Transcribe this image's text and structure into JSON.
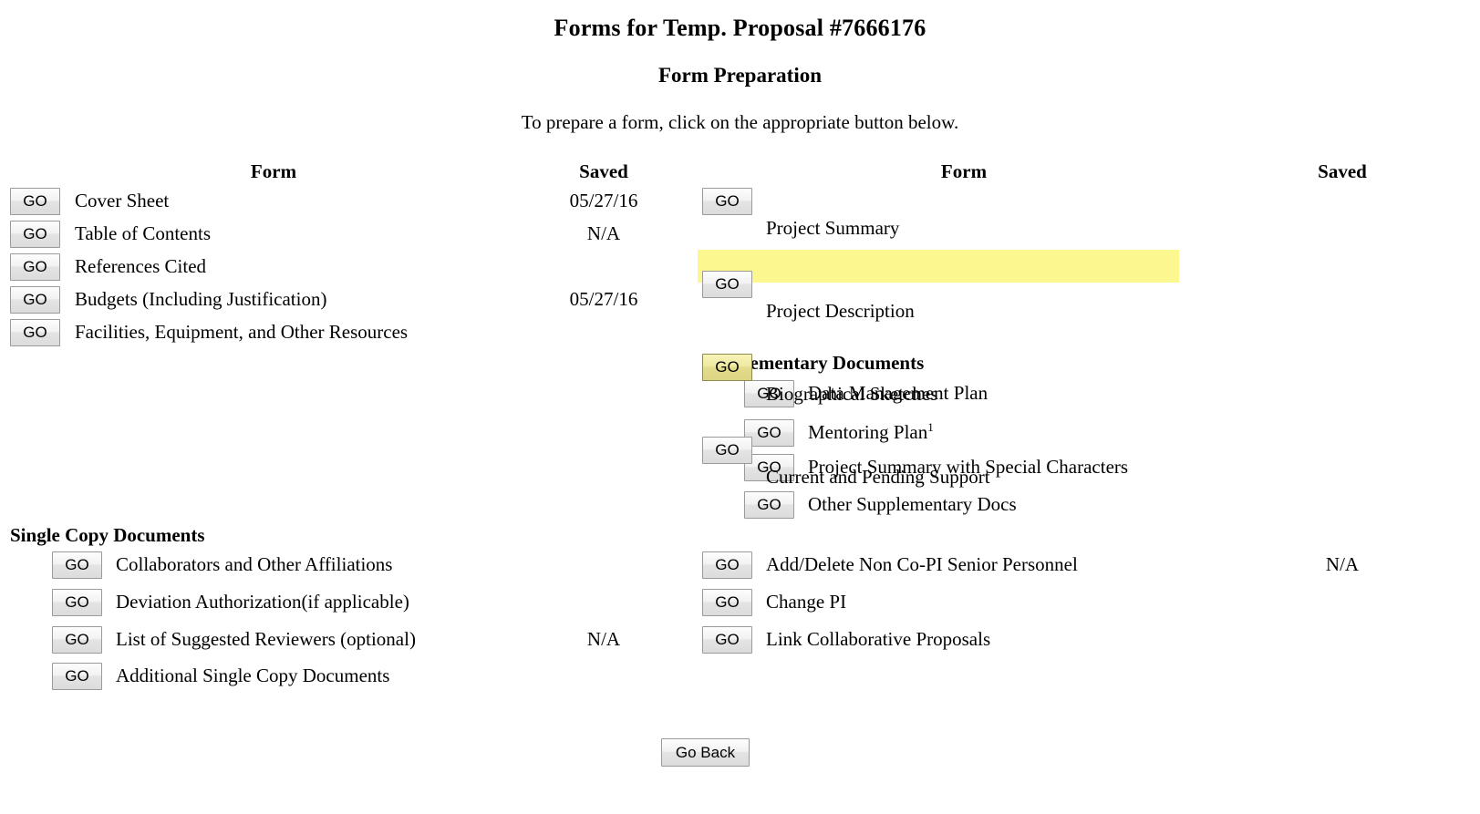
{
  "page": {
    "title": "Forms for Temp. Proposal #7666176",
    "subtitle": "Form Preparation",
    "instruction": "To prepare a form, click on the appropriate button below."
  },
  "columns": {
    "form_header_left": "Form",
    "saved_header_left": "Saved",
    "form_header_right": "Form",
    "saved_header_right": "Saved"
  },
  "button_label": "GO",
  "colors": {
    "highlight": "#fcf88f",
    "button_face": "#e4e4e4",
    "button_border": "#9a9a9a",
    "text": "#000000",
    "background": "#ffffff"
  },
  "left_column": {
    "rows": [
      {
        "go": "GO",
        "label": "Cover Sheet",
        "saved": "05/27/16"
      },
      {
        "go": "GO",
        "label": "Table of Contents",
        "saved": "N/A"
      },
      {
        "go": "GO",
        "label": "References Cited",
        "saved": ""
      },
      {
        "go": "GO",
        "label": "Budgets (Including Justification)",
        "saved": "05/27/16"
      },
      {
        "go": "GO",
        "label": "Facilities, Equipment, and Other Resources",
        "saved": ""
      }
    ]
  },
  "right_column": {
    "rows": [
      {
        "go": "GO",
        "label": "Project Summary",
        "saved": "",
        "highlighted": false
      },
      {
        "go": "GO",
        "label": "Project Description",
        "saved": "",
        "highlighted": false
      },
      {
        "go": "GO",
        "label": "Biographical Sketches",
        "saved": "",
        "highlighted": true
      },
      {
        "go": "GO",
        "label": "Current and Pending Support",
        "saved": "",
        "highlighted": false
      }
    ]
  },
  "supplementary": {
    "heading": "Supplementary Documents",
    "rows": [
      {
        "go": "GO",
        "label": "Data Management Plan",
        "footnote": ""
      },
      {
        "go": "GO",
        "label": "Mentoring Plan",
        "footnote": "1"
      },
      {
        "go": "GO",
        "label": "Project Summary with Special Characters",
        "footnote": ""
      },
      {
        "go": "GO",
        "label": "Other Supplementary Docs",
        "footnote": ""
      }
    ]
  },
  "single_copy": {
    "heading": "Single Copy Documents",
    "left_rows": [
      {
        "go": "GO",
        "label": "Collaborators and Other Affiliations",
        "saved": ""
      },
      {
        "go": "GO",
        "label": "Deviation Authorization(if applicable)",
        "saved": ""
      },
      {
        "go": "GO",
        "label": "List of Suggested Reviewers (optional)",
        "saved": "N/A"
      },
      {
        "go": "GO",
        "label": "Additional Single Copy Documents",
        "saved": ""
      }
    ],
    "right_rows": [
      {
        "go": "GO",
        "label": "Add/Delete Non Co-PI Senior Personnel",
        "saved": "N/A"
      },
      {
        "go": "GO",
        "label": "Change PI",
        "saved": ""
      },
      {
        "go": "GO",
        "label": "Link Collaborative Proposals",
        "saved": ""
      }
    ]
  },
  "footer": {
    "go_back_label": "Go Back"
  }
}
